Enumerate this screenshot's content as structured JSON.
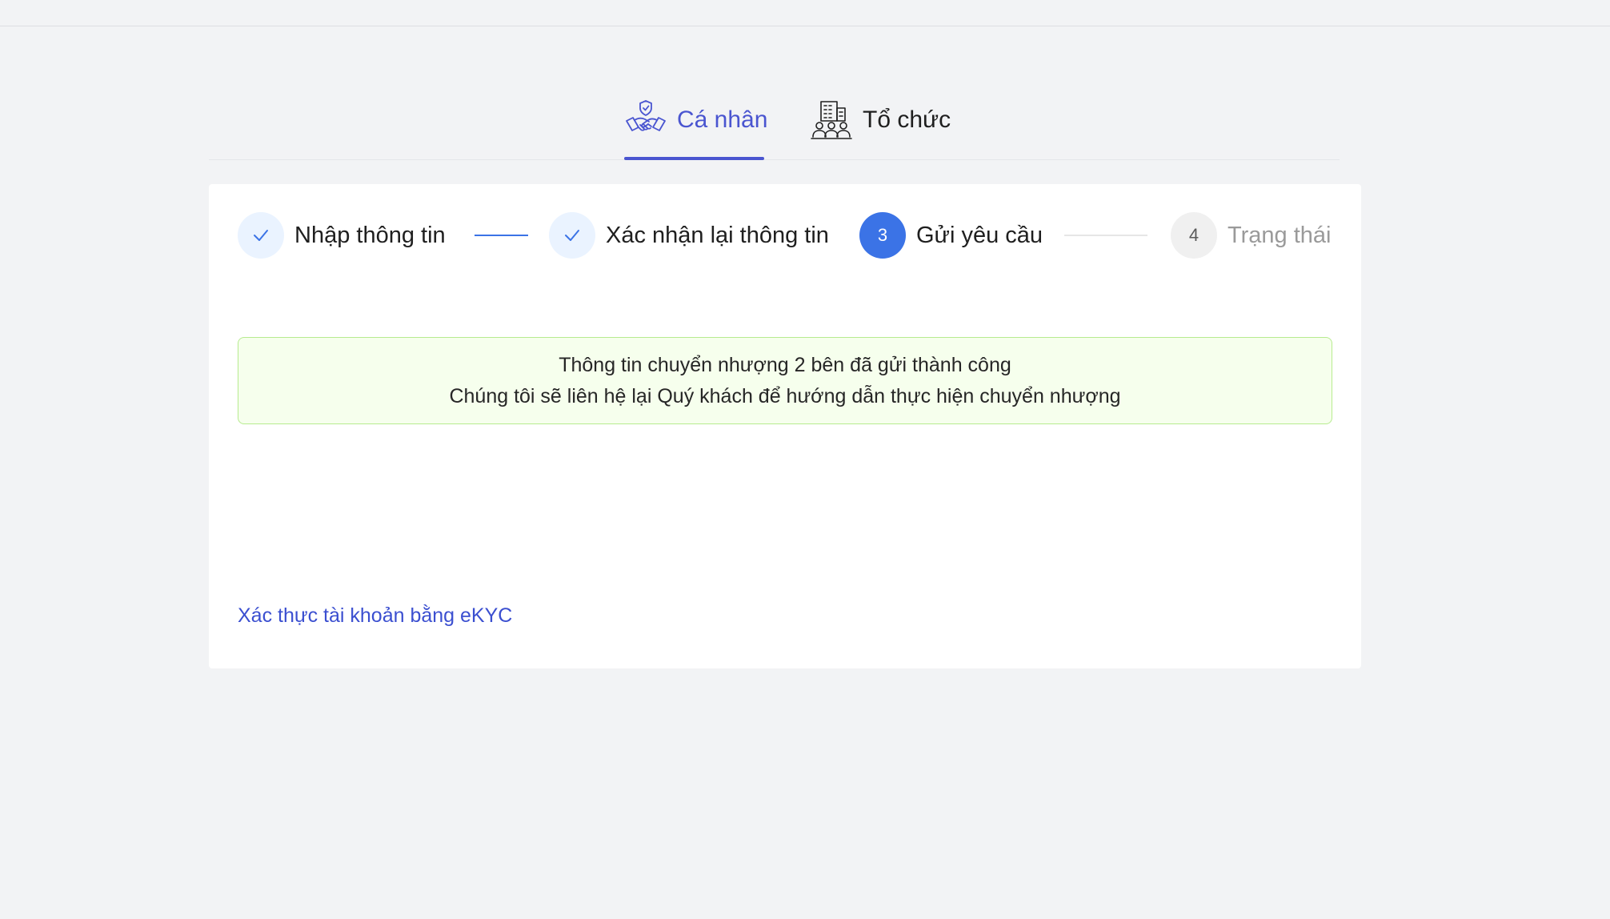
{
  "tabs": [
    {
      "label": "Cá nhân",
      "icon": "handshake-shield-icon",
      "active": true
    },
    {
      "label": "Tổ chức",
      "icon": "building-people-icon",
      "active": false
    }
  ],
  "steps": [
    {
      "label": "Nhập thông tin",
      "status": "done",
      "number": ""
    },
    {
      "label": "Xác nhận lại thông tin",
      "status": "done",
      "number": ""
    },
    {
      "label": "Gửi yêu cầu",
      "status": "active",
      "number": "3"
    },
    {
      "label": "Trạng thái",
      "status": "pending",
      "number": "4"
    }
  ],
  "alert": {
    "line1": "Thông tin chuyển nhượng 2 bên đã gửi thành công",
    "line2": "Chúng tôi sẽ liên hệ lại Quý khách để hướng dẫn thực hiện chuyển nhượng"
  },
  "ekyc_link": "Xác thực tài khoản bằng eKYC",
  "colors": {
    "accent": "#4a55d0",
    "step_active": "#3b73e6",
    "success_bg": "#f6ffed",
    "success_border": "#b7eb8f"
  }
}
